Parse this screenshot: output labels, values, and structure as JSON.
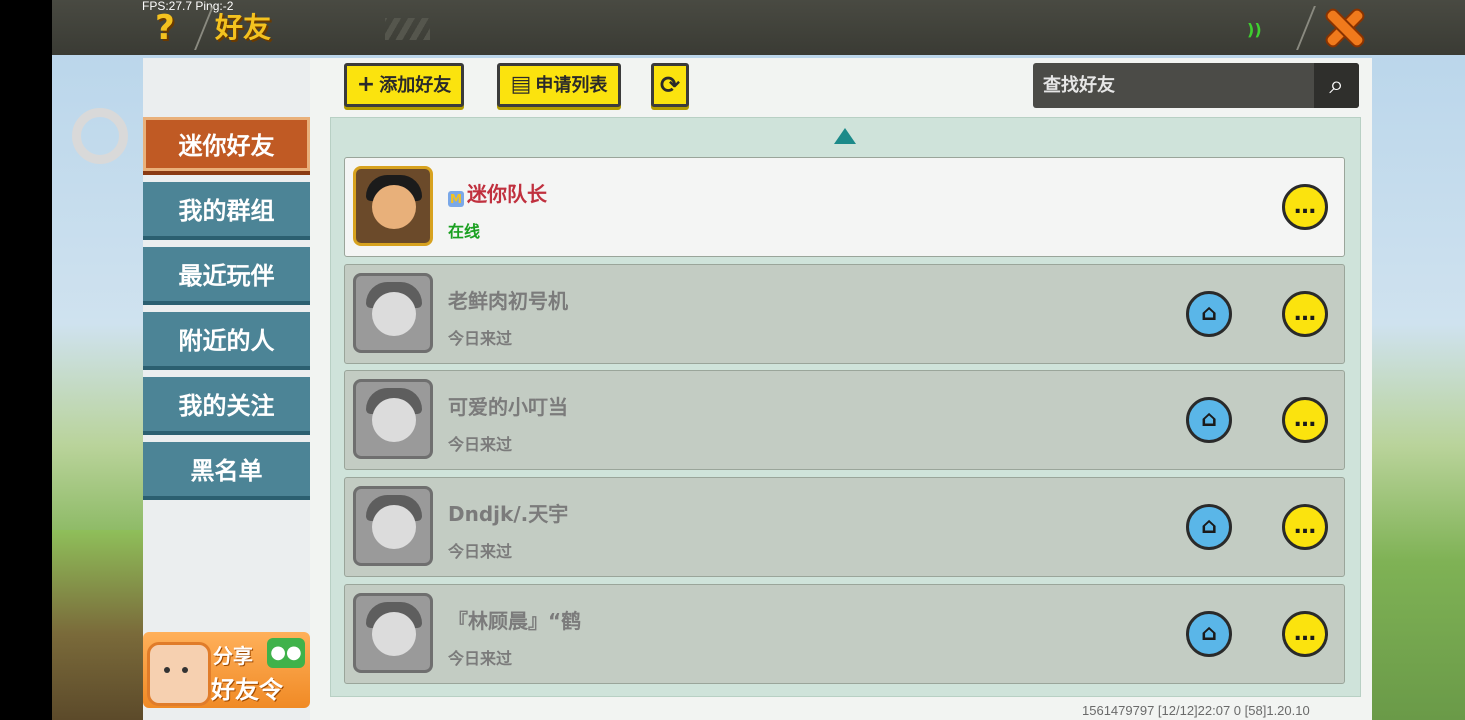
{
  "overlay": {
    "fps": "FPS:27.7  Ping:-2"
  },
  "header": {
    "help_icon": "question-mark-icon",
    "title": "好友",
    "status_icon": "signal-icon",
    "close_icon": "close-x-icon"
  },
  "sidebar": {
    "tabs": [
      {
        "label": "迷你好友",
        "active": true
      },
      {
        "label": "我的群组",
        "active": false
      },
      {
        "label": "最近玩伴",
        "active": false
      },
      {
        "label": "附近的人",
        "active": false
      },
      {
        "label": "我的关注",
        "active": false
      },
      {
        "label": "黑名单",
        "active": false
      }
    ],
    "share": {
      "line1": "分享",
      "line2": "好友令",
      "icon": "wechat-icon"
    }
  },
  "toolbar": {
    "add_friend": "添加好友",
    "apply_list": "申请列表",
    "refresh_icon": "refresh-icon",
    "search_placeholder": "查找好友",
    "search_icon": "search-icon"
  },
  "friends": [
    {
      "name": "迷你队长",
      "status": "在线",
      "online": true,
      "has_home": false
    },
    {
      "name": "老鲜肉初号机",
      "status": "今日来过",
      "online": false,
      "has_home": true
    },
    {
      "name": "可爱的小叮当",
      "status": "今日来过",
      "online": false,
      "has_home": true
    },
    {
      "name": "Dndjk/.天宇",
      "status": "今日来过",
      "online": false,
      "has_home": true
    },
    {
      "name": "『林顾晨』“鹤",
      "status": "今日来过",
      "online": false,
      "has_home": true
    }
  ],
  "footer": {
    "info": "1561479797   [12/12]22:07 0  [58]1.20.10"
  },
  "colors": {
    "accent_yellow": "#fbe30e",
    "tab_active": "#c05a24",
    "tab_inactive": "#4c8496",
    "online_green": "#1aa020",
    "name_red": "#c0303e"
  }
}
